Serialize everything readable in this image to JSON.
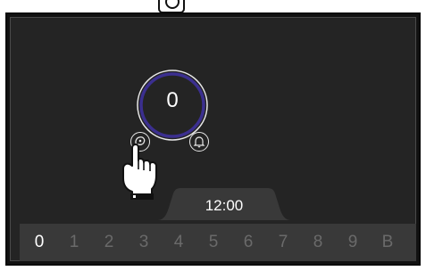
{
  "colors": {
    "background": "#242424",
    "dial_ring": "#3b2f8f",
    "text_primary": "#ffffff",
    "text_dim": "#6a6a6a",
    "strip": "#393939"
  },
  "icons": {
    "top": "camera-icon",
    "left_button": "meat-icon",
    "right_button": "bell-icon",
    "pointer": "hand-pointer-icon"
  },
  "dial": {
    "value": "0"
  },
  "time": {
    "label": "12:00"
  },
  "numbers": {
    "selected_index": 0,
    "items": [
      "0",
      "1",
      "2",
      "3",
      "4",
      "5",
      "6",
      "7",
      "8",
      "9",
      "B"
    ]
  }
}
